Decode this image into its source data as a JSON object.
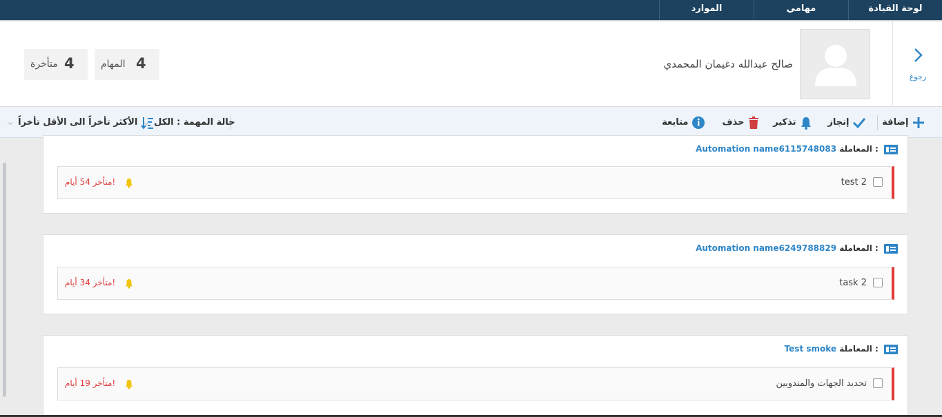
{
  "nav": {
    "items": [
      "لوحة القيادة",
      "مهامي",
      "الموارد"
    ]
  },
  "profile": {
    "back_label": "رجوع",
    "user_name": "صالح عبدالله دغيمان المحمدي",
    "stats": {
      "tasks_count": "4",
      "tasks_label": "المهام",
      "late_count": "4",
      "late_label": "متأخرة"
    }
  },
  "toolbar": {
    "add": "إضافة",
    "done": "إنجاز",
    "remind": "تذكير",
    "delete": "حذف",
    "follow": "متابعة",
    "status_filter": "حالة المهمة : الكل",
    "sort": "الأكثر تأخراً الى الأقل تأخراً"
  },
  "colors": {
    "nav_bg": "#1d4260",
    "accent": "#2e86c8",
    "late": "#e03b3b",
    "bell": "#f2c40d"
  },
  "cards": [
    {
      "transaction_label": "المعاملة :",
      "transaction_name": "Automation name6115748083",
      "task": {
        "name": "test 2",
        "late_text": "متأخر 54 أيام!"
      }
    },
    {
      "transaction_label": "المعاملة :",
      "transaction_name": "Automation name6249788829",
      "task": {
        "name": "task 2",
        "late_text": "متأخر 34 أيام!"
      }
    },
    {
      "transaction_label": "المعاملة :",
      "transaction_name": "Test smoke",
      "task": {
        "name": "تحديد الجهات والمندوبين",
        "late_text": "متأخر 19 أيام!"
      }
    }
  ]
}
